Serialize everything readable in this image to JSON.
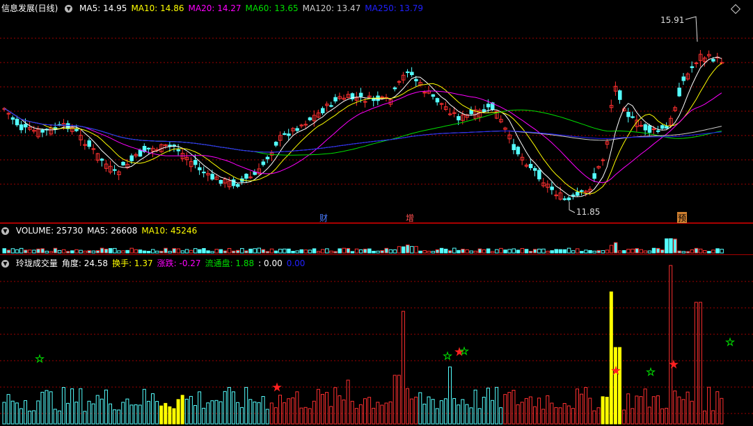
{
  "main": {
    "title": "信息发展(日线)",
    "ma_labels": [
      {
        "text": "MA5: 14.95",
        "color": "#ffffff"
      },
      {
        "text": "MA10: 14.86",
        "color": "#ffff00"
      },
      {
        "text": "MA20: 14.27",
        "color": "#ff00ff"
      },
      {
        "text": "MA60: 13.65",
        "color": "#00e000"
      },
      {
        "text": "MA120: 13.47",
        "color": "#cccccc"
      },
      {
        "text": "MA250: 13.79",
        "color": "#2020ff"
      }
    ],
    "high_label": "15.91",
    "low_label": "11.85",
    "markers": {
      "cai": "财",
      "zeng": "增",
      "yu": "预"
    }
  },
  "volume": {
    "labels": [
      {
        "text": "VOLUME: 25730",
        "color": "#ffffff"
      },
      {
        "text": "MA5: 26608",
        "color": "#ffffff"
      },
      {
        "text": "MA10: 45246",
        "color": "#ffff00"
      }
    ]
  },
  "indicator": {
    "labels": [
      {
        "text": "玲珑成交量",
        "color": "#ffffff"
      },
      {
        "text": "角度: 24.58",
        "color": "#ffffff"
      },
      {
        "text": "换手: 1.37",
        "color": "#ffff00"
      },
      {
        "text": "涨跌: -0.27",
        "color": "#ff00ff"
      },
      {
        "text": "流通盘: 1.88",
        "color": "#00e000"
      },
      {
        "text": ": 0.00",
        "color": "#ffffff"
      },
      {
        "text": "0.00",
        "color": "#2020ff"
      }
    ]
  },
  "colors": {
    "up": "#ff3030",
    "down": "#54ffff",
    "grid": "#a00000",
    "yellow": "#ffff00"
  }
}
